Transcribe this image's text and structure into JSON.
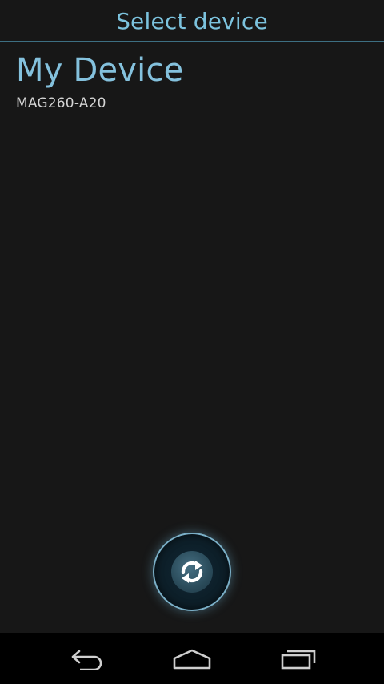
{
  "header": {
    "title": "Select device"
  },
  "devices": [
    {
      "name": "My Device",
      "model": "MAG260-A20"
    }
  ],
  "refresh_button": {
    "icon": "refresh-icon"
  },
  "navbar": {
    "icons": [
      "back-icon",
      "home-icon",
      "recents-icon"
    ]
  },
  "colors": {
    "accent": "#7cc3de",
    "background": "#171717",
    "navbar": "#000000"
  }
}
